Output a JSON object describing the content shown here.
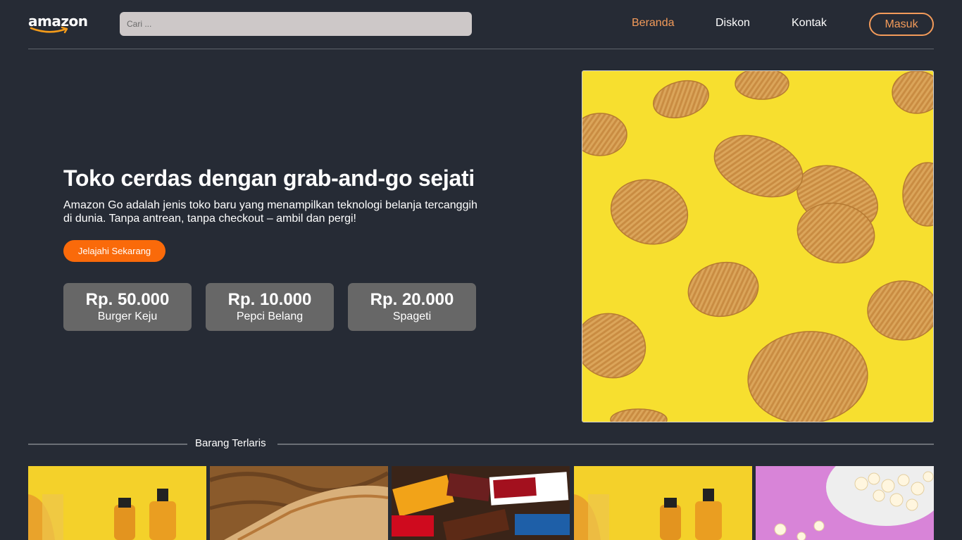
{
  "brand": {
    "logo_text": "amazon",
    "accent_color": "#f39b5a",
    "cta_color": "#fa6a0a"
  },
  "search": {
    "placeholder": "Cari ..."
  },
  "nav": {
    "items": [
      "Beranda",
      "Diskon",
      "Kontak"
    ],
    "active": "Beranda",
    "login_label": "Masuk"
  },
  "hero": {
    "title": "Toko cerdas dengan grab-and-go sejati",
    "description_line1": "Amazon Go adalah jenis toko baru yang menampilkan teknologi belanja tercanggih",
    "description_line2": "di dunia. Tanpa antrean, tanpa checkout – ambil dan pergi!",
    "cta_label": "Jelajahi Sekarang",
    "prices": [
      {
        "amount": "Rp. 50.000",
        "name": "Burger Keju"
      },
      {
        "amount": "Rp. 10.000",
        "name": "Pepci Belang"
      },
      {
        "amount": "Rp. 20.000",
        "name": "Spageti"
      }
    ],
    "image": "potato-chips-on-yellow"
  },
  "bestsellers": {
    "title": "Barang Terlaris",
    "products": [
      {
        "image": "bottled-drinks-on-yellow"
      },
      {
        "image": "grilled-sandwich"
      },
      {
        "image": "chocolate-bars"
      },
      {
        "image": "bottled-drinks-on-yellow"
      },
      {
        "image": "popcorn-on-pink"
      }
    ]
  }
}
